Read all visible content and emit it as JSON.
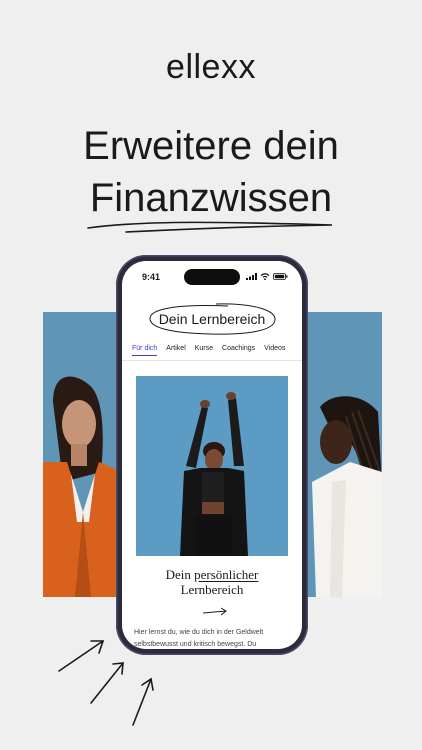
{
  "brand": "ellexx",
  "headline": {
    "line1": "Erweitere dein",
    "line2": "Finanzwissen"
  },
  "phone": {
    "status_time": "9:41",
    "screen_title": "Dein Lernbereich",
    "tabs": [
      {
        "label": "Für dich",
        "active": true
      },
      {
        "label": "Artikel",
        "active": false
      },
      {
        "label": "Kurse",
        "active": false
      },
      {
        "label": "Coachings",
        "active": false
      },
      {
        "label": "Videos",
        "active": false
      }
    ],
    "card": {
      "title_part1": "Dein",
      "title_highlight": "persönlicher",
      "title_part2": "Lernbereich",
      "body": "Hier lernst du, wie du dich in der Geldwelt selbstbewusst und kritisch bewegst. Du"
    }
  },
  "colors": {
    "background": "#efefef",
    "accent": "#3b3bd6",
    "photo_sky": "#5f96b8",
    "phone_frame": "#2b2b3a"
  }
}
